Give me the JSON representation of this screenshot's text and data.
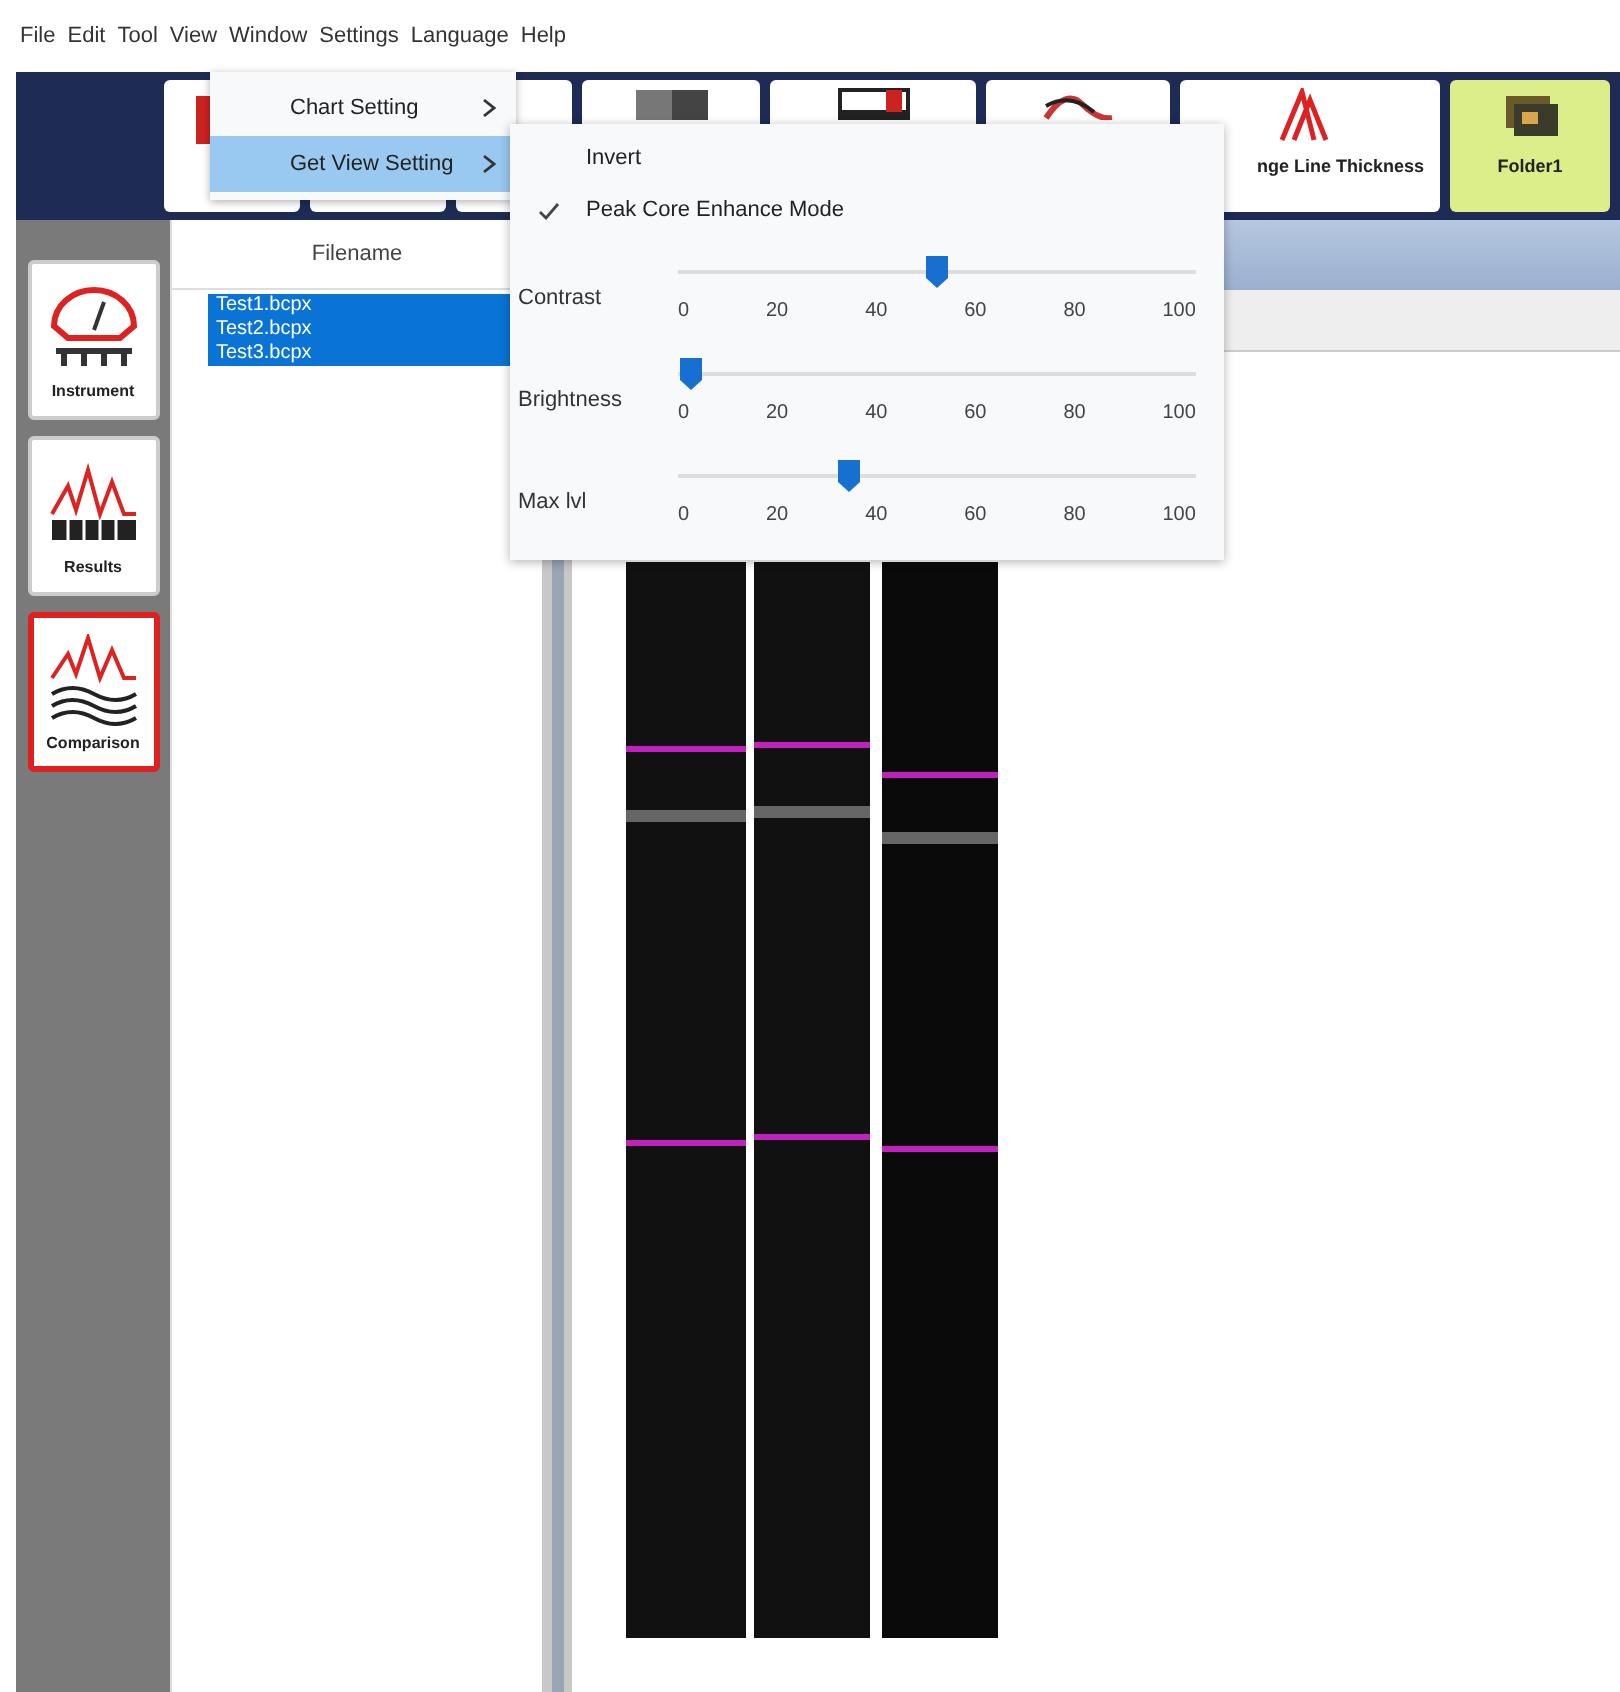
{
  "menu_bar": [
    "File",
    "Edit",
    "Tool",
    "View",
    "Window",
    "Settings",
    "Language",
    "Help"
  ],
  "toolbar": {
    "buttons": [
      {
        "selected": false
      },
      {
        "selected": false
      },
      {
        "selected": false
      },
      {
        "selected": false
      },
      {
        "selected": false
      },
      {
        "selected": false
      },
      {
        "label": "nge Line Thickness",
        "selected": false
      },
      {
        "label": "Folder1",
        "selected": true
      }
    ]
  },
  "sidebar": {
    "items": [
      {
        "label": "Instrument",
        "selected": false
      },
      {
        "label": "Results",
        "selected": false
      },
      {
        "label": "Comparison",
        "selected": true
      }
    ]
  },
  "file_list": {
    "header": "Filename",
    "rows": [
      {
        "name": "Test1.bcpx",
        "selected": true
      },
      {
        "name": "Test2.bcpx",
        "selected": true
      },
      {
        "name": "Test3.bcpx",
        "selected": true
      }
    ]
  },
  "view_menu": {
    "items": [
      {
        "label": "Chart Setting",
        "selected": false
      },
      {
        "label": "Get View Setting",
        "selected": true
      }
    ]
  },
  "view_submenu": {
    "items": [
      {
        "kind": "check",
        "label": "Invert",
        "checked": false
      },
      {
        "kind": "check",
        "label": "Peak Core Enhance Mode",
        "checked": true
      },
      {
        "kind": "slider",
        "label": "Contrast",
        "level": 0.5,
        "ticks": [
          "0",
          "20",
          "40",
          "60",
          "80",
          "100"
        ]
      },
      {
        "kind": "slider",
        "label": "Brightness",
        "level": 0,
        "ticks": [
          "0",
          "20",
          "40",
          "60",
          "80",
          "100"
        ]
      },
      {
        "kind": "slider",
        "label": "Max lvl",
        "level": 0.32,
        "ticks": [
          "0",
          "20",
          "40",
          "60",
          "80",
          "100"
        ]
      }
    ]
  }
}
